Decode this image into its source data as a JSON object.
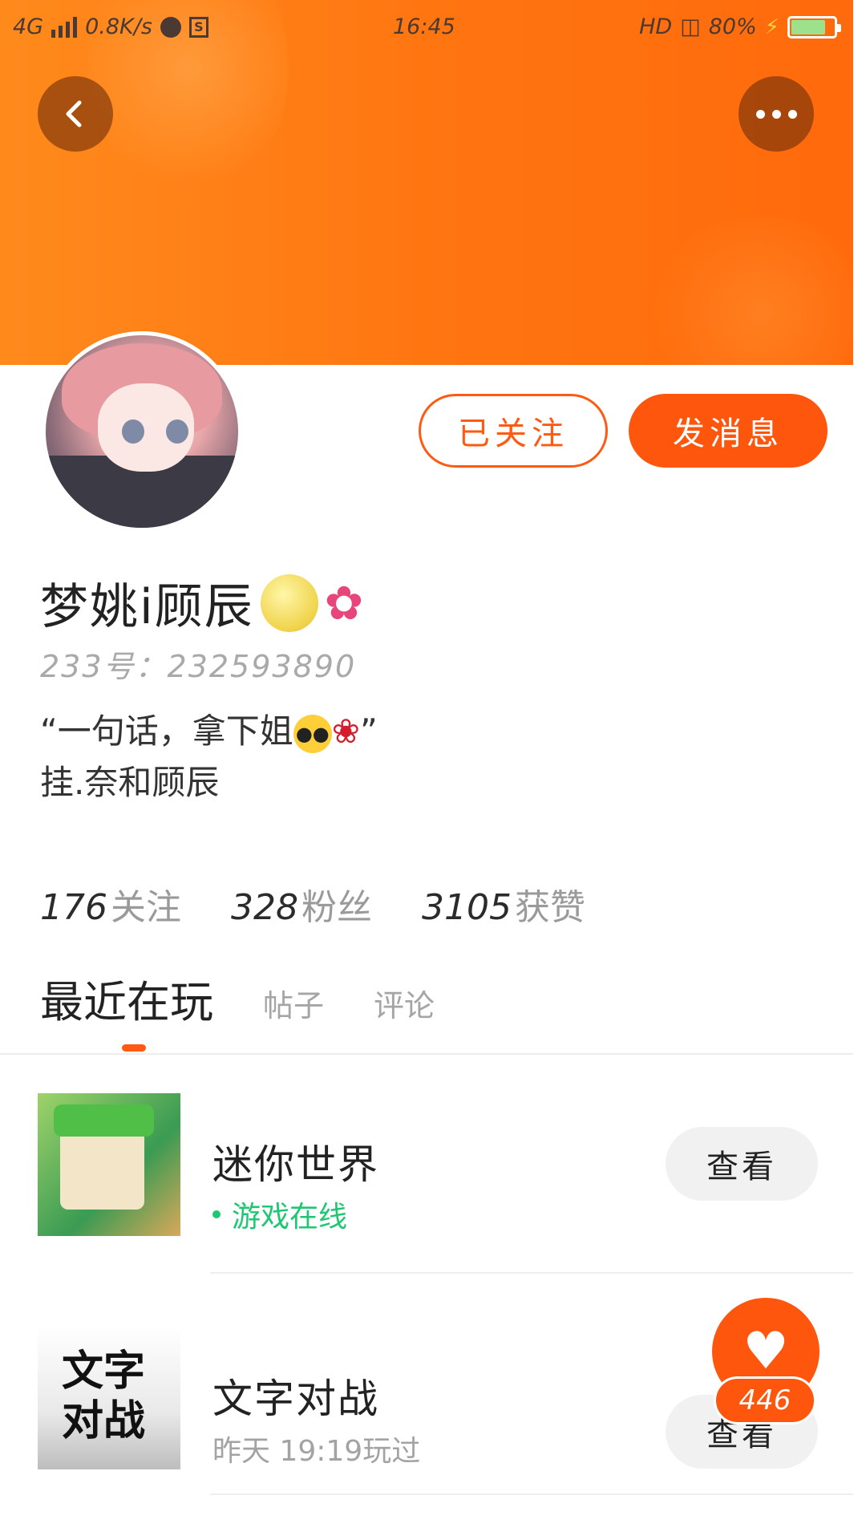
{
  "status_bar": {
    "network": "4G",
    "speed": "0.8K/s",
    "time": "16:45",
    "hd": "HD",
    "battery_text": "80%",
    "battery_level": 0.8
  },
  "header": {
    "back_icon": "chevron-left-icon",
    "more_icon": "more-dots-icon"
  },
  "profile": {
    "name": "梦姚i顾辰",
    "uid": "233号：232593890",
    "bio_line1_prefix": "“一句话，拿下姐",
    "bio_line1_suffix": "”",
    "bio_line2": "挂.奈和顾辰",
    "follow_button": "已关注",
    "message_button": "发消息"
  },
  "stats": [
    {
      "value": "176",
      "label": "关注"
    },
    {
      "value": "328",
      "label": "粉丝"
    },
    {
      "value": "3105",
      "label": "获赞"
    }
  ],
  "tabs": [
    {
      "label": "最近在玩"
    },
    {
      "label": "帖子"
    },
    {
      "label": "评论"
    }
  ],
  "games": [
    {
      "name": "迷你世界",
      "status": "游戏在线",
      "action": "查看",
      "thumb_text": ""
    },
    {
      "name": "文字对战",
      "status": "昨天 19:19玩过",
      "action": "查看",
      "thumb_text": "文字对战"
    }
  ],
  "likes": {
    "count": "446"
  },
  "colors": {
    "accent": "#ff560e",
    "banner": "#ff7a14",
    "online": "#1fc773"
  }
}
